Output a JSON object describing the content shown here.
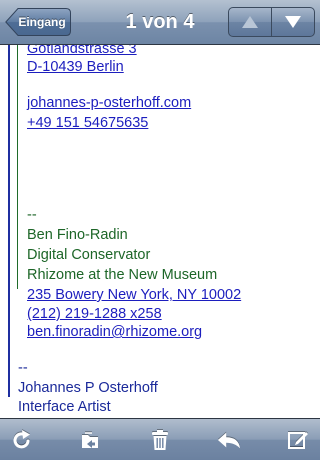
{
  "nav": {
    "back_label": "Eingang",
    "title": "1 von 4"
  },
  "message": {
    "address_street": "Gotlandstrasse 3",
    "address_city": "D-10439 Berlin",
    "email_johannes": "johannes-p-osterhoff.com",
    "phone_johannes": "+49 151 54675635",
    "sig_sep_inner": "--",
    "ben_name": "Ben Fino-Radin",
    "ben_role": "Digital Conservator",
    "ben_org": "Rhizome at the New Museum",
    "ben_address": "235 Bowery New York, NY 10002",
    "ben_phone": "(212) 219-1288 x258",
    "ben_email": "ben.finoradin@rhizome.org",
    "sig_sep_outer": "--",
    "johannes_name": "Johannes P Osterhoff",
    "johannes_role": "Interface Artist"
  },
  "toolbar": {
    "icons": [
      "refresh-icon",
      "move-folder-icon",
      "trash-icon",
      "reply-icon",
      "compose-icon"
    ]
  },
  "colors": {
    "link": "#1c1ebe",
    "quote_inner_text": "#1d6628",
    "quote_outer_text": "#1b2a9a",
    "bar": "#6d85a4"
  }
}
